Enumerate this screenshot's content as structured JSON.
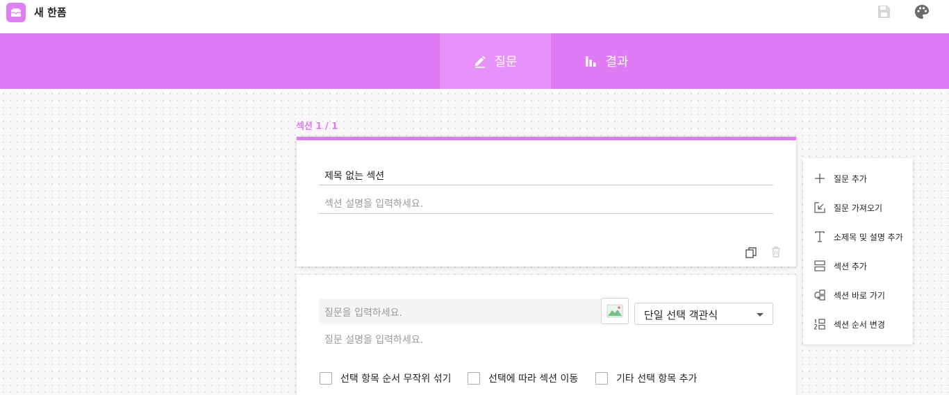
{
  "app": {
    "doc_title": "새 한폼"
  },
  "tabs": [
    {
      "label": "질문",
      "icon": "pencil-icon",
      "active": true
    },
    {
      "label": "결과",
      "icon": "bar-chart-icon",
      "active": false
    }
  ],
  "section": {
    "label": "섹션 1 / 1",
    "title": "제목 없는 섹션",
    "description_placeholder": "섹션 설명을 입력하세요."
  },
  "question": {
    "title_placeholder": "질문을 입력하세요.",
    "description_placeholder": "질문 설명을 입력하세요.",
    "type_selected": "단일 선택 객관식",
    "options": [
      {
        "label": "선택 항목 순서 무작위 섞기",
        "checked": false
      },
      {
        "label": "선택에 따라 섹션 이동",
        "checked": false
      },
      {
        "label": "기타 선택 항목 추가",
        "checked": false
      }
    ]
  },
  "side_toolbar": {
    "items": [
      {
        "label": "질문 추가",
        "icon": "plus-icon"
      },
      {
        "label": "질문 가져오기",
        "icon": "import-icon"
      },
      {
        "label": "소제목 및 설명 추가",
        "icon": "text-icon"
      },
      {
        "label": "섹션 추가",
        "icon": "section-icon"
      },
      {
        "label": "섹션 바로 가기",
        "icon": "section-jump-icon"
      },
      {
        "label": "섹션 순서 변경",
        "icon": "reorder-icon"
      }
    ]
  },
  "colors": {
    "accent": "#e07bf6",
    "accent_active_tab": "#e692f8"
  }
}
